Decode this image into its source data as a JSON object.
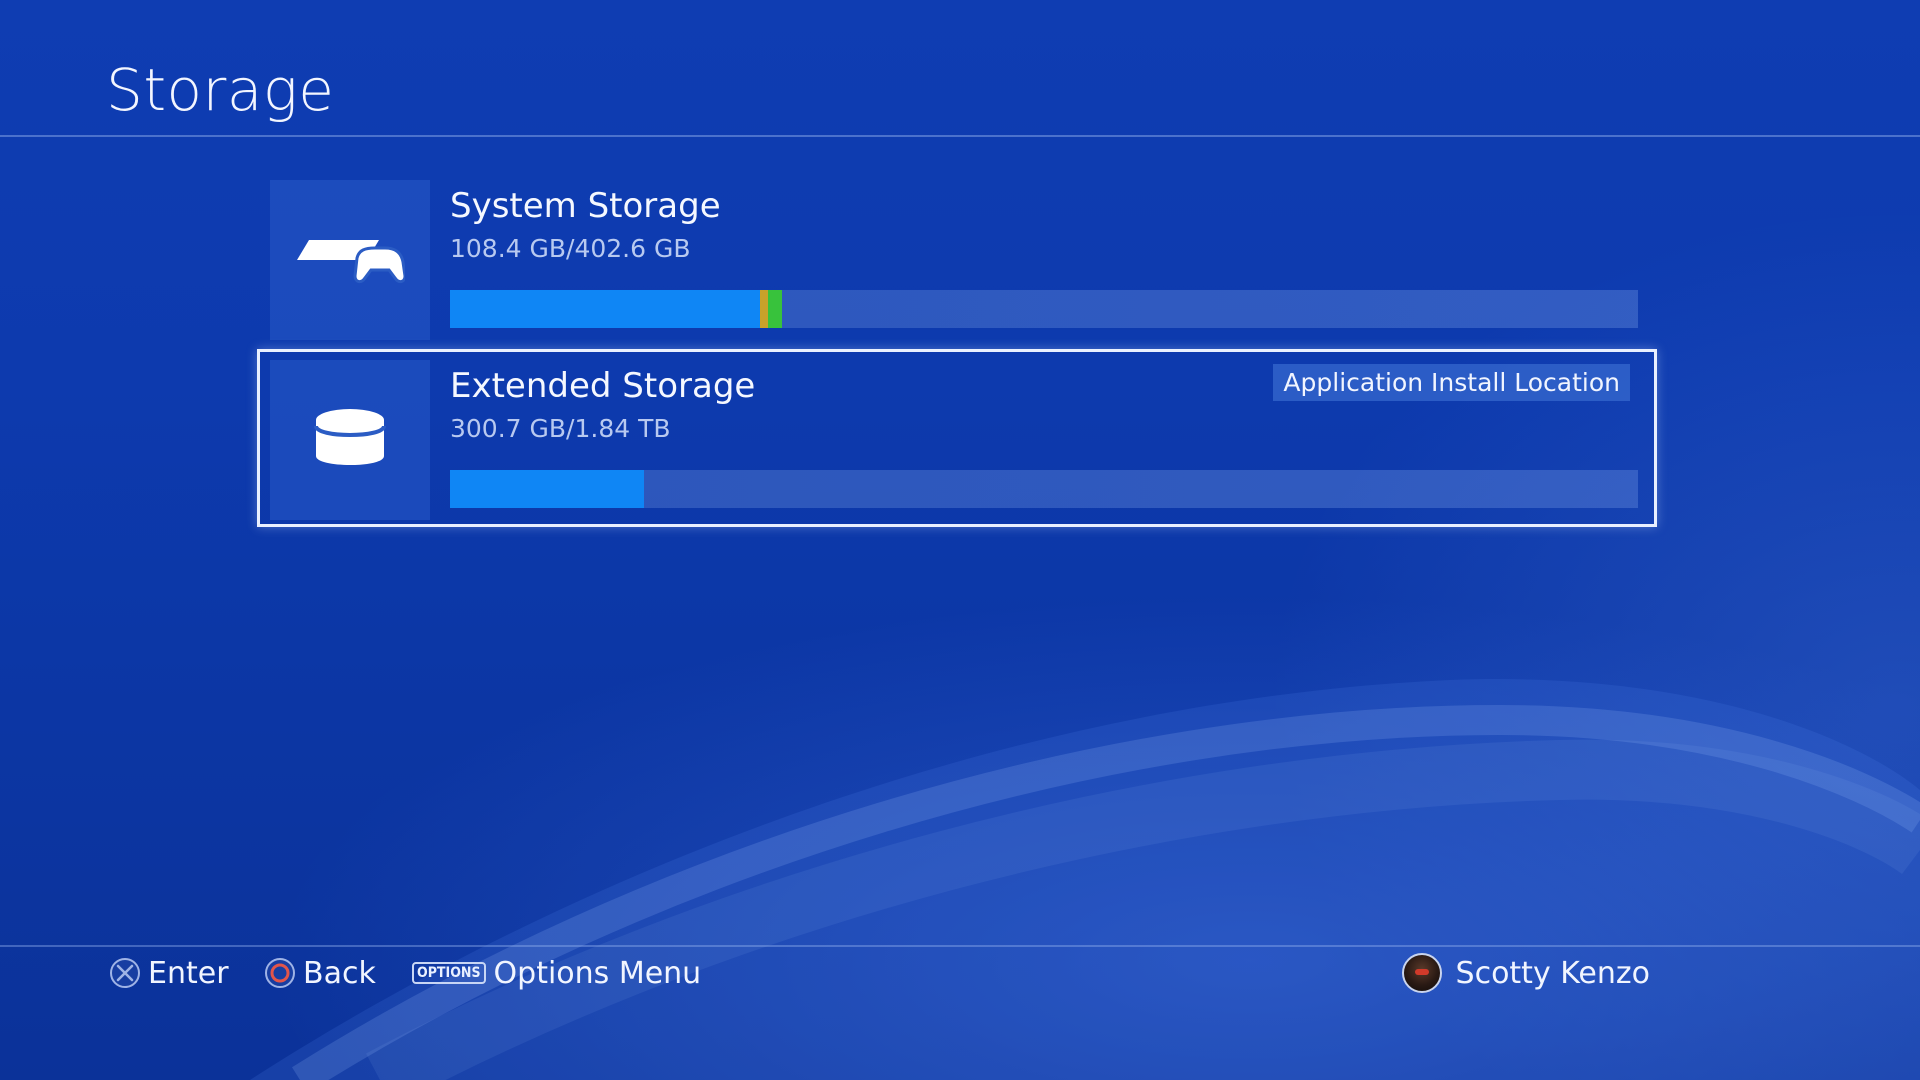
{
  "page": {
    "title": "Storage"
  },
  "storage_items": [
    {
      "name": "System Storage",
      "usage": "108.4 GB/402.6 GB",
      "icon": "console-controller-icon",
      "fill_fraction": 0.269,
      "selected": false
    },
    {
      "name": "Extended Storage",
      "usage": "300.7 GB/1.84 TB",
      "icon": "hard-drive-icon",
      "badge": "Application Install Location",
      "fill_fraction": 0.163,
      "selected": true
    }
  ],
  "footer": {
    "enter_label": "Enter",
    "back_label": "Back",
    "options_glyph": "OPTIONS",
    "options_label": "Options Menu",
    "user_name": "Scotty Kenzo"
  },
  "colors": {
    "accent_blue": "#0f86f5",
    "background": "#0d3aae",
    "segment_orange": "#d8a020",
    "segment_green": "#3cc83c"
  }
}
